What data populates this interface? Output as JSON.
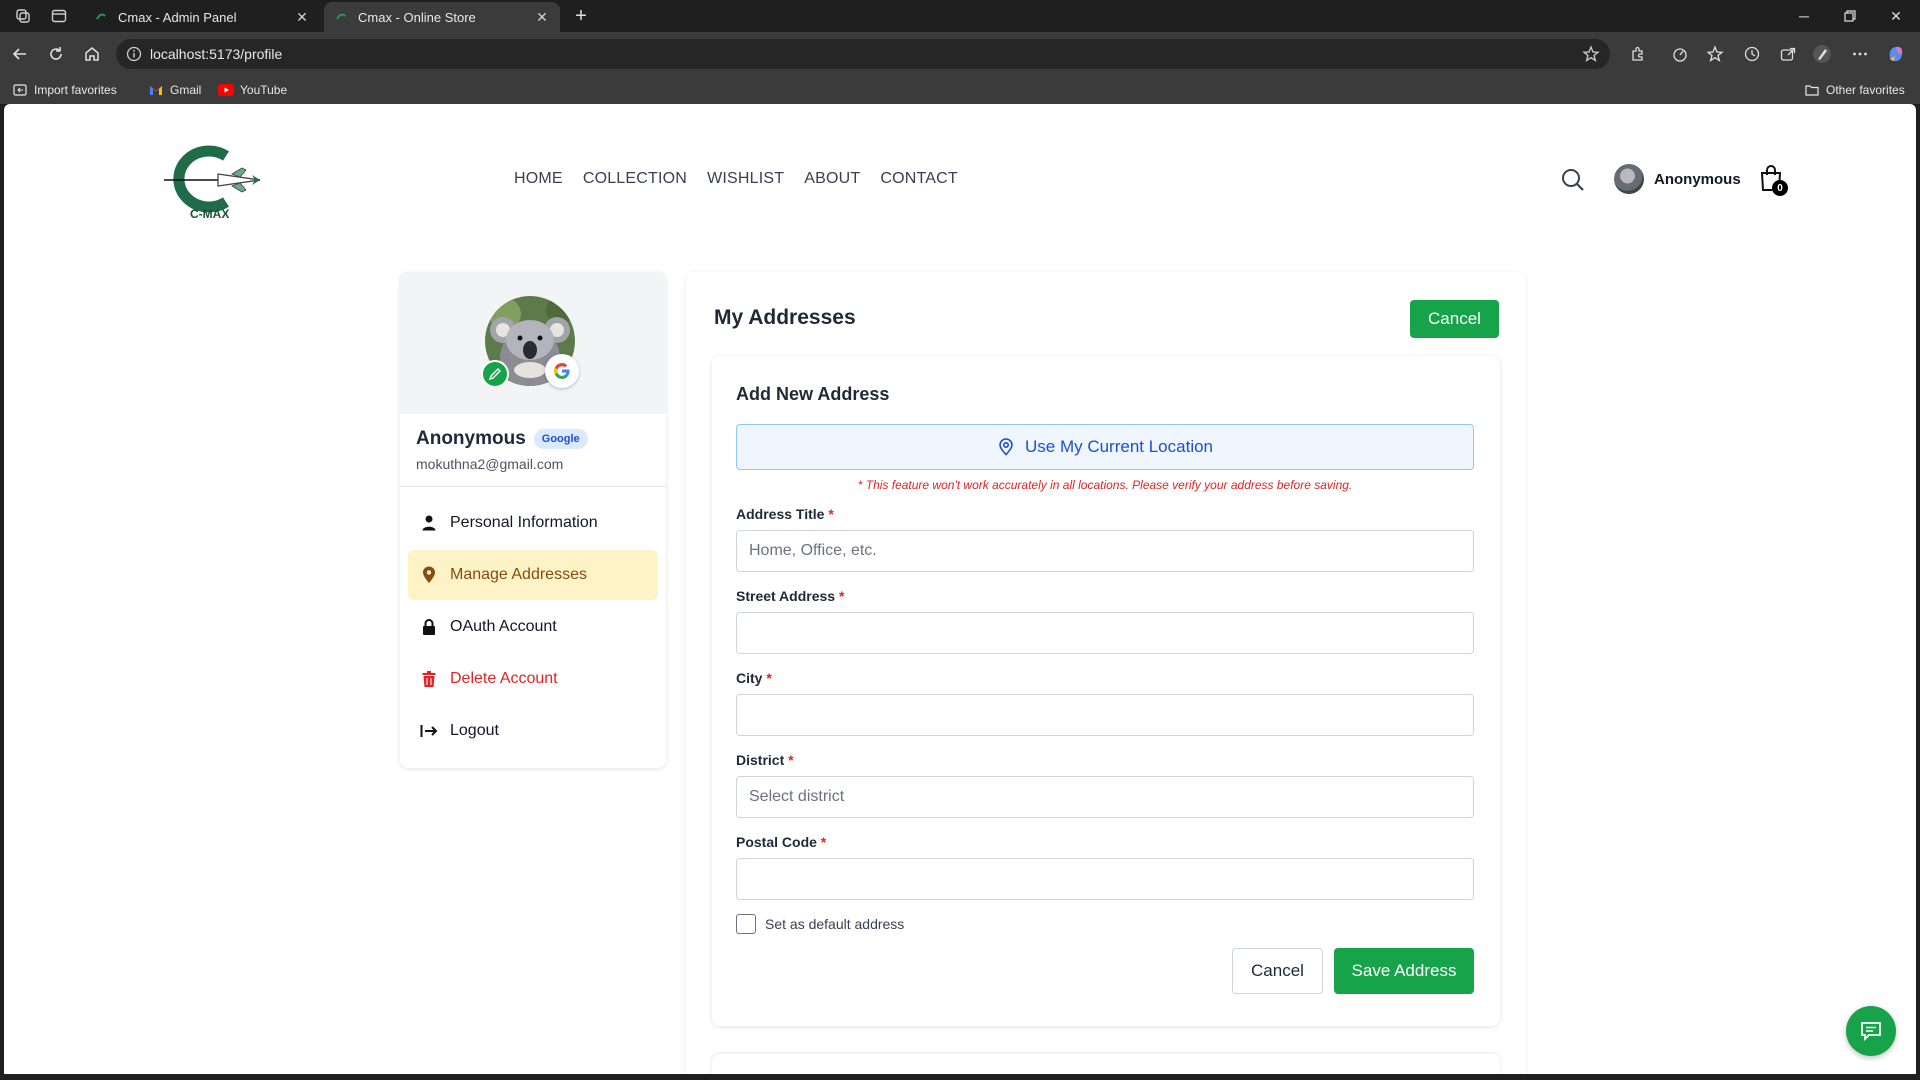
{
  "browser": {
    "tabs": [
      {
        "title": "Cmax - Admin Panel",
        "active": false
      },
      {
        "title": "Cmax - Online Store",
        "active": true
      }
    ],
    "url": "localhost:5173/profile",
    "bookmarks": [
      "Import favorites",
      "Gmail",
      "YouTube"
    ],
    "other_favorites": "Other favorites"
  },
  "header": {
    "logo_text": "C-MAX",
    "nav": [
      "HOME",
      "COLLECTION",
      "WISHLIST",
      "ABOUT",
      "CONTACT"
    ],
    "user_name": "Anonymous",
    "cart_count": "0"
  },
  "sidebar": {
    "name": "Anonymous",
    "provider_badge": "Google",
    "email": "mokuthna2@gmail.com",
    "menu": [
      {
        "label": "Personal Information",
        "icon": "person-icon"
      },
      {
        "label": "Manage Addresses",
        "icon": "map-pin-icon",
        "active": true
      },
      {
        "label": "OAuth Account",
        "icon": "lock-icon"
      },
      {
        "label": "Delete Account",
        "icon": "trash-icon",
        "danger": true
      },
      {
        "label": "Logout",
        "icon": "logout-icon"
      }
    ]
  },
  "main": {
    "title": "My Addresses",
    "cancel_top": "Cancel",
    "form": {
      "title": "Add New Address",
      "location_button": "Use My Current Location",
      "location_warning": "* This feature won't work accurately in all locations. Please verify your address before saving.",
      "fields": {
        "address_title": {
          "label": "Address Title",
          "placeholder": "Home, Office, etc.",
          "value": ""
        },
        "street": {
          "label": "Street Address",
          "placeholder": "",
          "value": ""
        },
        "city": {
          "label": "City",
          "placeholder": "",
          "value": ""
        },
        "district": {
          "label": "District",
          "placeholder": "Select district"
        },
        "postal": {
          "label": "Postal Code",
          "placeholder": "",
          "value": ""
        }
      },
      "required_mark": "*",
      "default_checkbox": {
        "label": "Set as default address",
        "checked": false
      },
      "cancel": "Cancel",
      "save": "Save Address"
    }
  },
  "colors": {
    "primary": "#16a34a",
    "danger": "#dc2626",
    "active_bg": "#fef3c7",
    "link_blue": "#1d4ed8"
  }
}
